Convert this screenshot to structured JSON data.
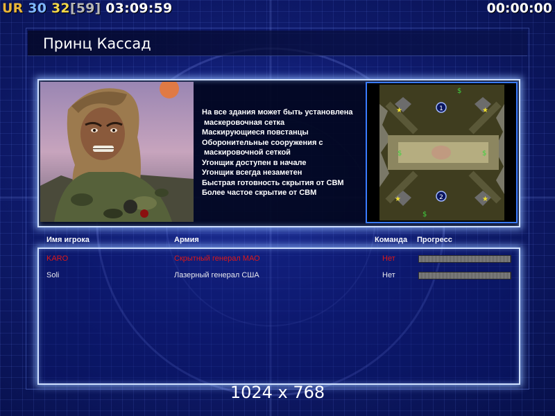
{
  "hud": {
    "ur": "UR",
    "num1": "30",
    "num2": "32",
    "num3": "[59]",
    "clock": "03:09:59",
    "timer": "00:00:00"
  },
  "title": "Принц Кассад",
  "description_lines": [
    "На все здания может быть установлена",
    " маскеровочная сетка",
    "Маскирующиеся повстанцы",
    "Оборонительные сооружения с",
    " маскировочной сеткой",
    "Угонщик доступен в начале",
    "Угонщик всегда незаметен",
    "Быстрая готовность скрытия от СВМ",
    "Более частое скрытие от СВМ"
  ],
  "minimap": {
    "start_markers": [
      "1",
      "2"
    ],
    "supply_symbol": "$"
  },
  "players_table": {
    "headers": {
      "player": "Имя игрока",
      "army": "Армия",
      "team": "Команда",
      "progress": "Прогресс"
    },
    "rows": [
      {
        "name": "KARO",
        "army": "Скрытный генерал МАО",
        "team": "Нет",
        "color": "#e01818",
        "progress": 1.0
      },
      {
        "name": "Soli",
        "army": "Лазерный генерал США",
        "team": "Нет",
        "color": "#e8e8ee",
        "progress": 1.0
      }
    ]
  },
  "resolution": "1024 x 768",
  "colors": {
    "accent_border": "#cfe0ff",
    "minimap_border": "#3a7cff",
    "player1": "#e01818"
  }
}
